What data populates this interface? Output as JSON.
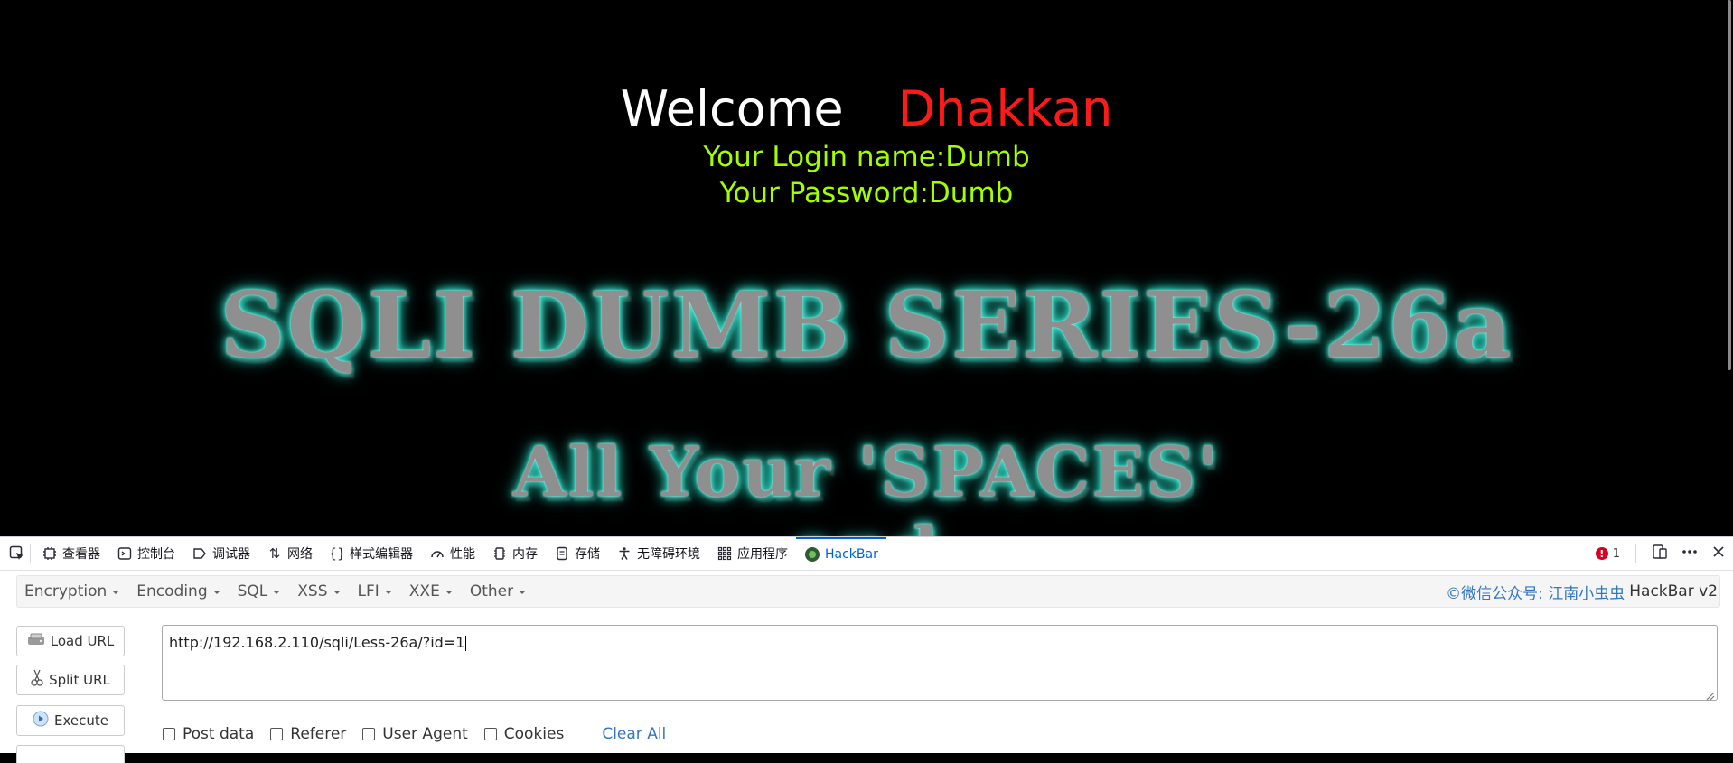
{
  "page": {
    "welcome": "Welcome",
    "name": "Dhakkan",
    "login_name": "Your Login name:Dumb",
    "password": "Your Password:Dumb",
    "banner_title": "SQLI DUMB SERIES-26a",
    "banner_subtitle": "All Your 'SPACES'",
    "banner_subtitle2": "and"
  },
  "devtools": {
    "tabs": [
      {
        "label": "查看器",
        "icon": "inspector-icon"
      },
      {
        "label": "控制台",
        "icon": "console-icon"
      },
      {
        "label": "调试器",
        "icon": "debugger-icon"
      },
      {
        "label": "网络",
        "icon": "network-icon"
      },
      {
        "label": "样式编辑器",
        "icon": "style-editor-icon"
      },
      {
        "label": "性能",
        "icon": "performance-icon"
      },
      {
        "label": "内存",
        "icon": "memory-icon"
      },
      {
        "label": "存储",
        "icon": "storage-icon"
      },
      {
        "label": "无障碍环境",
        "icon": "accessibility-icon"
      },
      {
        "label": "应用程序",
        "icon": "application-icon"
      },
      {
        "label": "HackBar",
        "icon": "hackbar-icon"
      }
    ],
    "error_count": "1"
  },
  "hackbar": {
    "menus": [
      "Encryption",
      "Encoding",
      "SQL",
      "XSS",
      "LFI",
      "XXE",
      "Other"
    ],
    "credit_wechat": "©微信公众号: 江南小虫虫",
    "credit_name": "HackBar v2",
    "buttons": {
      "load": "Load URL",
      "split": "Split URL",
      "execute": "Execute"
    },
    "url_value": "http://192.168.2.110/sqli/Less-26a/?id=1",
    "options": [
      "Post data",
      "Referer",
      "User Agent",
      "Cookies"
    ],
    "clear_all": "Clear All"
  },
  "colors": {
    "accent": "#0060df",
    "name_red": "#ff1a1a",
    "login_green": "#a2ff00",
    "glow": "#2fe6cf"
  }
}
